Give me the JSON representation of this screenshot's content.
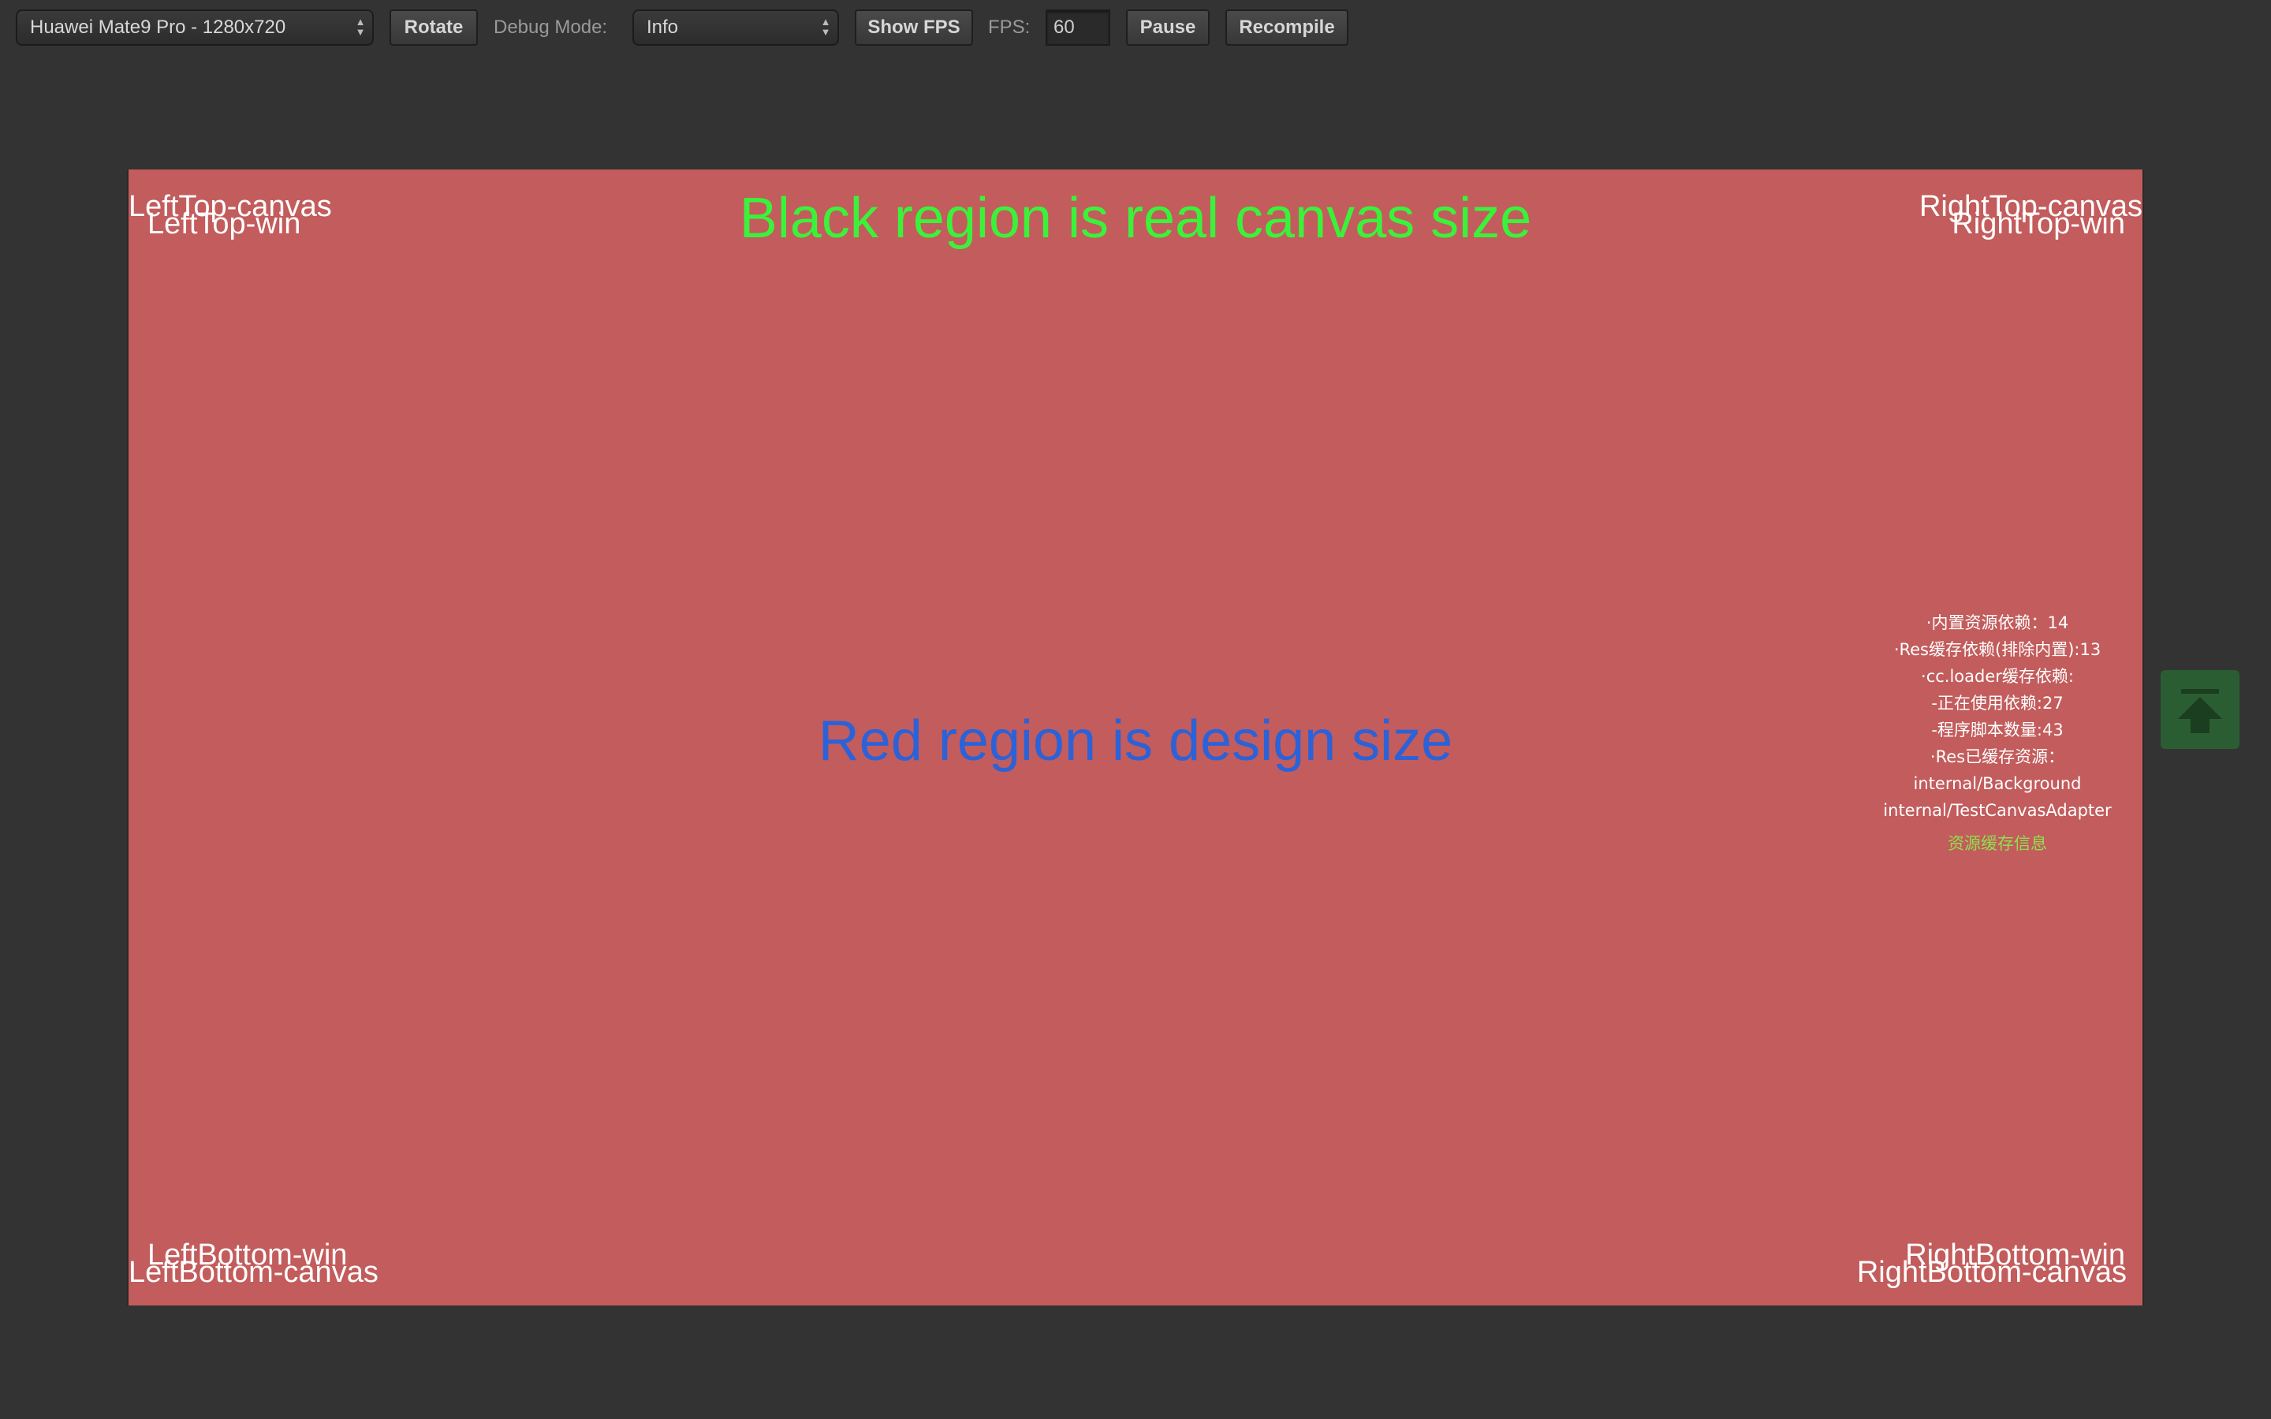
{
  "toolbar": {
    "device_select": "Huawei Mate9 Pro - 1280x720",
    "rotate_label": "Rotate",
    "debug_mode_label": "Debug Mode:",
    "debug_mode_value": "Info",
    "show_fps_label": "Show FPS",
    "fps_label": "FPS:",
    "fps_value": "60",
    "pause_label": "Pause",
    "recompile_label": "Recompile"
  },
  "canvas": {
    "colors": {
      "design_region": "#c35c5c",
      "top_title": "#3bf23b",
      "center_title": "#2c62d8",
      "link": "#8ee04e"
    },
    "top_title": "Black region is real canvas size",
    "center_title": "Red region is design size",
    "corners": {
      "left_top_canvas": "LeftTop-canvas",
      "left_top_win": "LeftTop-win",
      "right_top_canvas": "RightTop-canvas",
      "right_top_win": "RightTop-win",
      "left_bottom_win": "LeftBottom-win",
      "left_bottom_canvas": "LeftBottom-canvas",
      "right_bottom_win": "RightBottom-win",
      "right_bottom_canvas": "RightBottom-canvas"
    },
    "cache_info": {
      "lines": [
        "·内置资源依赖：14",
        "·Res缓存依赖(排除内置):13",
        "·cc.loader缓存依赖:",
        "-正在使用依赖:27",
        "-程序脚本数量:43",
        "·Res已缓存资源：",
        "internal/Background",
        "internal/TestCanvasAdapter"
      ],
      "link": "资源缓存信息"
    },
    "scroll_top_icon": "arrow-up-to-top-icon"
  }
}
